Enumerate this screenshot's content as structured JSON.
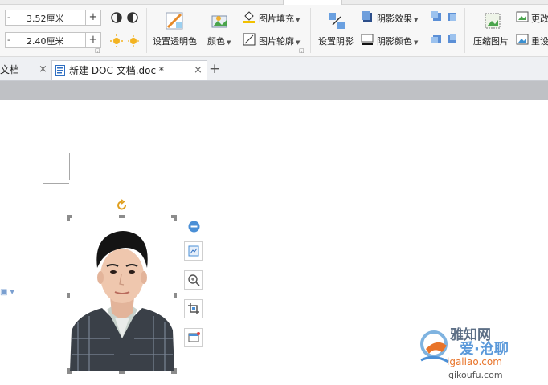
{
  "ribbon": {
    "height_value": "3.52厘米",
    "width_value": "2.40厘米",
    "minus_symbol": "-",
    "plus_symbol": "+",
    "set_transparent_color": "设置透明色",
    "color": "颜色",
    "picture_fill": "图片填充",
    "picture_outline": "图片轮廓",
    "set_shadow": "设置阴影",
    "shadow_effect": "阴影效果",
    "shadow_color": "阴影颜色",
    "compress_picture": "压缩图片",
    "change_picture": "更改",
    "reset_picture": "重设"
  },
  "tabs": {
    "items": [
      {
        "label": "文档",
        "close": "×"
      },
      {
        "label": "新建 DOC 文档.doc *",
        "close": "×"
      }
    ],
    "add": "+"
  },
  "watermark": {
    "line1": "雅知网",
    "line2": "爱·沧聊",
    "line3": "igaliao.com",
    "line4": "qikoufu.com"
  },
  "colors": {
    "accent_blue": "#4a8fd6",
    "handle_gray": "#8c8c8c",
    "rotate_orange": "#e0a020",
    "watermark_orange": "#e8742a"
  }
}
